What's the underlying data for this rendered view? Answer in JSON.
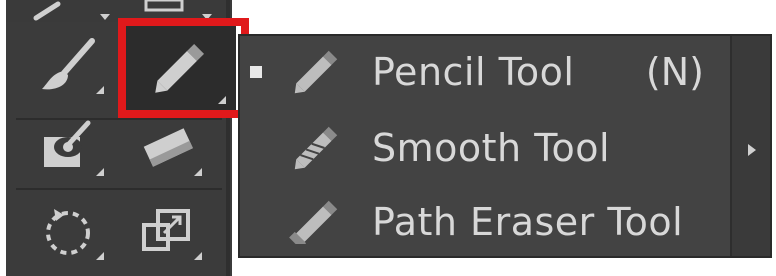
{
  "toolbar": {
    "tools": [
      {
        "name": "paintbrush-tool",
        "icon": "paintbrush-icon"
      },
      {
        "name": "pencil-tool",
        "icon": "pencil-icon",
        "selected": true
      },
      {
        "name": "shaper-tool",
        "icon": "shaper-icon"
      },
      {
        "name": "eraser-tool",
        "icon": "eraser-icon"
      },
      {
        "name": "rotate-tool",
        "icon": "rotate-icon"
      },
      {
        "name": "scale-tool",
        "icon": "scale-icon"
      }
    ]
  },
  "flyout": {
    "items": [
      {
        "label": "Pencil Tool",
        "shortcut": "(N)",
        "active": true,
        "icon": "pencil-icon"
      },
      {
        "label": "Smooth Tool",
        "shortcut": "",
        "active": false,
        "icon": "smooth-icon"
      },
      {
        "label": "Path Eraser Tool",
        "shortcut": "",
        "active": false,
        "icon": "path-eraser-icon"
      }
    ]
  },
  "colors": {
    "panel_bg": "#3b3b3b",
    "menu_bg": "#434343",
    "text": "#d8d8d8",
    "highlight": "#e0191b"
  }
}
